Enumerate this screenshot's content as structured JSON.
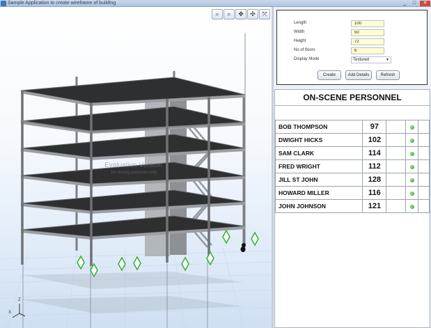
{
  "window": {
    "title": "Sample Application to create wireframe of building",
    "controls": [
      "_",
      "□",
      "✕"
    ]
  },
  "viewport": {
    "toolbar": [
      {
        "name": "zoom-in-icon",
        "glyph": "⌕"
      },
      {
        "name": "zoom-out-icon",
        "glyph": "⌕"
      },
      {
        "name": "pan-icon",
        "glyph": "✥"
      },
      {
        "name": "rotate-icon",
        "glyph": "✣"
      },
      {
        "name": "fit-icon",
        "glyph": "⤧"
      }
    ],
    "watermark_title": "Evaluation Version",
    "watermark_subtitle": "for testing purposes only",
    "axis_z": "Z",
    "axis_x": "X"
  },
  "building_form": {
    "length_label": "Length",
    "length_value": "100",
    "width_label": "Width",
    "width_value": "50",
    "height_label": "Height",
    "height_value": "72",
    "floors_label": "No of floors",
    "floors_value": "6",
    "mode_label": "Display Mode",
    "mode_value": "Textured",
    "create_label": "Create",
    "add_details_label": "Add Details",
    "refresh_label": "Refresh"
  },
  "personnel": {
    "header": "ON-SCENE PERSONNEL",
    "status_color": "#3a9a33",
    "rows": [
      {
        "name": "BOB THOMPSON",
        "number": "97"
      },
      {
        "name": "DWIGHT HICKS",
        "number": "102"
      },
      {
        "name": "SAM CLARK",
        "number": "114"
      },
      {
        "name": "FRED WRIGHT",
        "number": "112"
      },
      {
        "name": "JILL ST JOHN",
        "number": "128"
      },
      {
        "name": "HOWARD MILLER",
        "number": "116"
      },
      {
        "name": "JOHN JOHNSON",
        "number": "121"
      }
    ]
  }
}
